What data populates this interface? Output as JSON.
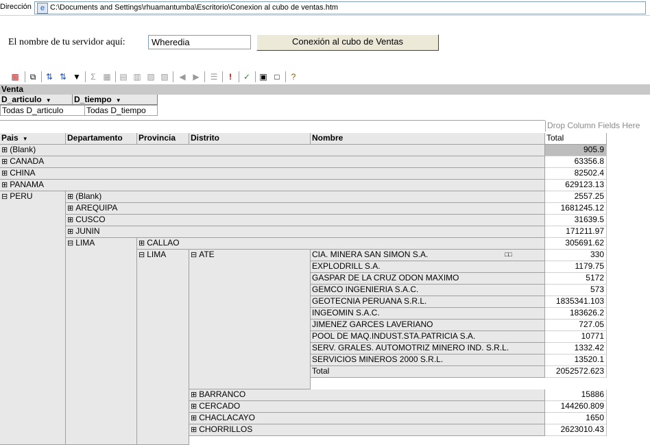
{
  "address": {
    "label": "Dirección",
    "path": "C:\\Documents and Settings\\rhuamantumba\\Escritorio\\Conexion al cubo de ventas.htm"
  },
  "server": {
    "label": "El nombre de tu servidor aquí:",
    "value": "Wheredia",
    "button": "Conexión al cubo de Ventas"
  },
  "pivot": {
    "title": "Venta",
    "filters": [
      {
        "field": "D_articulo",
        "value": "Todas D_articulo"
      },
      {
        "field": "D_tiempo",
        "value": "Todas D_tiempo"
      }
    ],
    "drop_label": "Drop Column Fields Here",
    "row_headers": [
      "Pais",
      "Departamento",
      "Provincia",
      "Distrito",
      "Nombre"
    ],
    "total_header": "Total",
    "countries": [
      {
        "name": "(Blank)",
        "total": "905.9"
      },
      {
        "name": "CANADA",
        "total": "63356.8"
      },
      {
        "name": "CHINA",
        "total": "82502.4"
      },
      {
        "name": "PANAMA",
        "total": "629123.13"
      },
      {
        "name": "PERU"
      }
    ],
    "departments": [
      {
        "name": "(Blank)",
        "total": "2557.25"
      },
      {
        "name": "AREQUIPA",
        "total": "1681245.12"
      },
      {
        "name": "CUSCO",
        "total": "31639.5"
      },
      {
        "name": "JUNIN",
        "total": "171211.97"
      },
      {
        "name": "LIMA"
      }
    ],
    "provinces": [
      {
        "name": "CALLAO",
        "total": "305691.62"
      },
      {
        "name": "LIMA"
      }
    ],
    "district_ate": "ATE",
    "companies": [
      {
        "name": "CIA. MINERA SAN SIMON S.A.",
        "total": "330"
      },
      {
        "name": "EXPLODRILL S.A.",
        "total": "1179.75"
      },
      {
        "name": "GASPAR DE LA CRUZ ODON MAXIMO",
        "total": "5172"
      },
      {
        "name": "GEMCO INGENIERIA S.A.C.",
        "total": "573"
      },
      {
        "name": "GEOTECNIA PERUANA S.R.L.",
        "total": "1835341.103"
      },
      {
        "name": "INGEOMIN S.A.C.",
        "total": "183626.2"
      },
      {
        "name": "JIMENEZ GARCES LAVERIANO",
        "total": "727.05"
      },
      {
        "name": "POOL DE MAQ.INDUST.STA.PATRICIA S.A.",
        "total": "10771"
      },
      {
        "name": "SERV. GRALES. AUTOMOTRIZ MINERO IND. S.R.L.",
        "total": "1332.42"
      },
      {
        "name": "SERVICIOS MINEROS 2000 S.R.L.",
        "total": "13520.1"
      },
      {
        "name": "Total",
        "total": "2052572.623"
      }
    ],
    "districts": [
      {
        "name": "BARRANCO",
        "total": "15886"
      },
      {
        "name": "CERCADO",
        "total": "144260.809"
      },
      {
        "name": "CHACLACAYO",
        "total": "1650"
      },
      {
        "name": "CHORRILLOS",
        "total": "2623010.43"
      }
    ]
  }
}
